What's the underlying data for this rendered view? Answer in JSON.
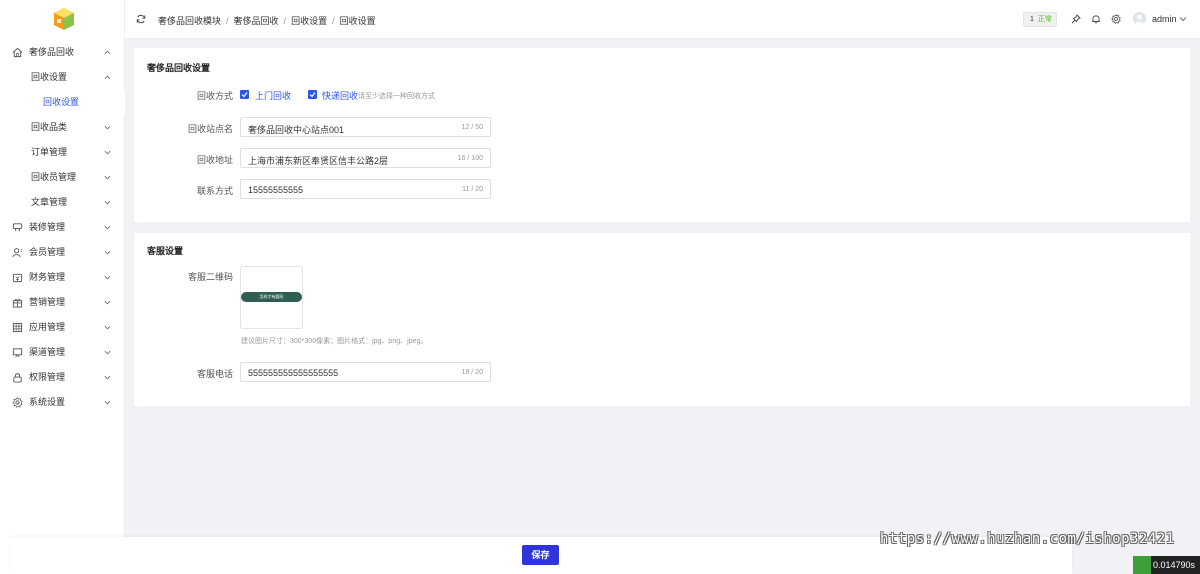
{
  "sidebar": {
    "items": [
      {
        "label": "奢侈品回收",
        "icon": "home-icon",
        "expanded": true
      },
      {
        "label": "回收设置",
        "expanded": true
      },
      {
        "label": "回收设置",
        "active": true
      },
      {
        "label": "回收品类"
      },
      {
        "label": "订单管理"
      },
      {
        "label": "回收员管理"
      },
      {
        "label": "文章管理"
      },
      {
        "label": "装修管理",
        "icon": "decorate-icon"
      },
      {
        "label": "会员管理",
        "icon": "user-icon"
      },
      {
        "label": "财务管理",
        "icon": "wallet-icon"
      },
      {
        "label": "营销管理",
        "icon": "gift-icon"
      },
      {
        "label": "应用管理",
        "icon": "app-grid-icon"
      },
      {
        "label": "渠道管理",
        "icon": "channel-icon"
      },
      {
        "label": "权限管理",
        "icon": "lock-icon"
      },
      {
        "label": "系统设置",
        "icon": "gear-icon"
      }
    ]
  },
  "header": {
    "breadcrumb": [
      "奢侈品回收模块",
      "奢侈品回收",
      "回收设置",
      "回收设置"
    ],
    "badge_count": "1",
    "badge_status": "正常",
    "username": "admin"
  },
  "recycle_settings": {
    "title": "奢侈品回收设置",
    "method_label": "回收方式",
    "method_options": [
      "上门回收",
      "快递回收"
    ],
    "method_hint": "请至少选择一种回收方式",
    "station_label": "回收站点名",
    "station_value": "奢侈品回收中心站点001",
    "station_count": "12 / 50",
    "address_label": "回收地址",
    "address_value": "上海市浦东新区奉贤区信丰公路2层",
    "address_count": "16 / 100",
    "contact_label": "联系方式",
    "contact_value": "15555555555",
    "contact_count": "11 / 20"
  },
  "service_settings": {
    "title": "客服设置",
    "qr_label": "客服二维码",
    "qr_image_caption": "怎样才有圆形",
    "qr_hint": "建议图片尺寸：300*300像素；图片格式：jpg、png、jpeg。",
    "phone_label": "客服电话",
    "phone_value": "555555555555555555",
    "phone_count": "18 / 20"
  },
  "footer": {
    "save_label": "保存"
  },
  "watermark": "https://www.huzhan.com/ishop32421",
  "timer": "0.014790s",
  "colors": {
    "primary": "#2f54eb",
    "save_button": "#2f35d8",
    "background": "#f0f2f5"
  }
}
